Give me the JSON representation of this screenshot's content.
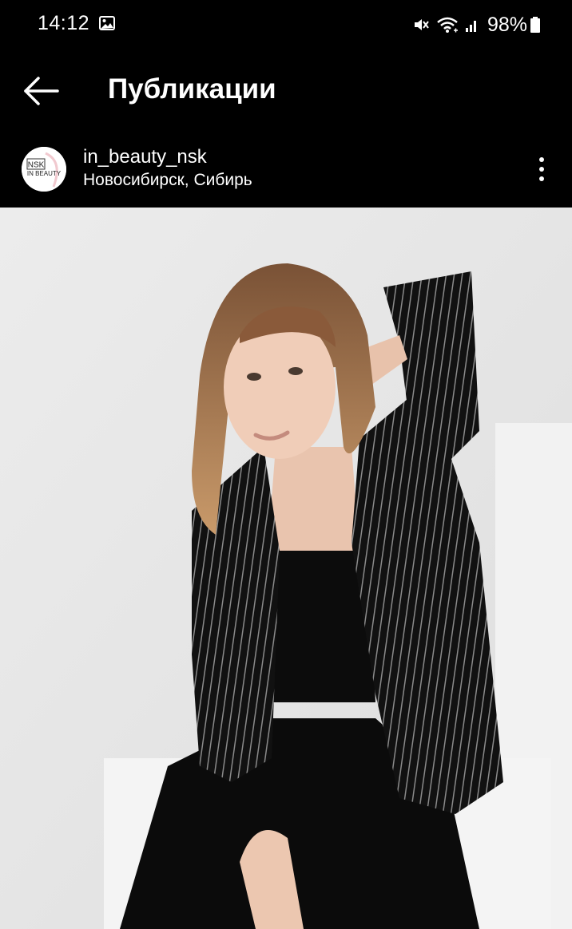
{
  "status_bar": {
    "time": "14:12",
    "battery": "98%",
    "icons": [
      "gallery-icon",
      "mute-icon",
      "wifi-icon",
      "signal-icon",
      "battery-icon"
    ]
  },
  "header": {
    "back_icon": "arrow-left-icon",
    "title": "Публикации"
  },
  "post": {
    "avatar_text_top": "NSK",
    "avatar_text_bottom": "IN BEAUTY",
    "username": "in_beauty_nsk",
    "location": "Новосибирск, Сибирь",
    "more_icon": "more-vertical-icon",
    "image": "photo of a young woman with long light-brown hair in a black pinstripe blazer, black crop top and black trousers, seated against a white backdrop"
  },
  "colors": {
    "background": "#000000",
    "text": "#ffffff",
    "photo_background": "#e9e9e9"
  }
}
